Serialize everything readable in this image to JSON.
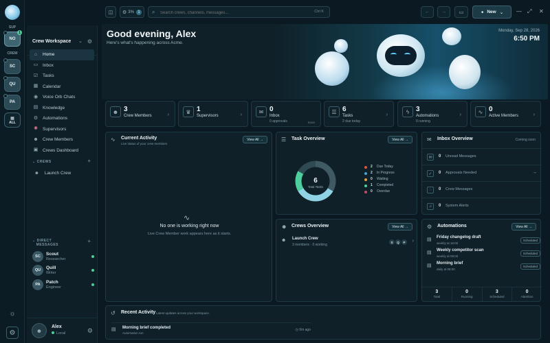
{
  "rail": {
    "sup_label": "SUP",
    "crew_label": "CREW",
    "workspaces": [
      {
        "initials": "NO",
        "badge": "1"
      },
      {
        "initials": "SC"
      },
      {
        "initials": "QU"
      },
      {
        "initials": "PA"
      }
    ],
    "all_label": "ALL"
  },
  "sidebar": {
    "workspace_name": "Crew Workspace",
    "nav": [
      "Home",
      "Inbox",
      "Tasks",
      "Calendar",
      "Voice Orb Chats",
      "Knowledge",
      "Automations",
      "Supervisors",
      "Crew Members",
      "Crews Dashboard"
    ],
    "crews_label": "CREWS",
    "crew_item": "Launch Crew",
    "dm_label_1": "DIRECT",
    "dm_label_2": "MESSAGES",
    "dms": [
      {
        "initials": "SC",
        "name": "Scout",
        "role": "Researcher"
      },
      {
        "initials": "QU",
        "name": "Quill",
        "role": "Writer"
      },
      {
        "initials": "PA",
        "name": "Patch",
        "role": "Engineer"
      }
    ],
    "user": {
      "name": "Alex",
      "status": "Local"
    }
  },
  "topbar": {
    "usage_pct": "3%",
    "usage_badge": "1",
    "search_placeholder": "Search crews, channels, messages...",
    "search_shortcut": "Ctrl K",
    "new_label": "New"
  },
  "hero": {
    "greeting": "Good evening, Alex",
    "subtitle": "Here's what's happening across Acme.",
    "date": "Monday, Sep 28, 2026",
    "time": "6:50 PM"
  },
  "stats": [
    {
      "value": "3",
      "label": "Crew Members",
      "sub": "",
      "tag": ""
    },
    {
      "value": "1",
      "label": "Supervisors",
      "sub": "",
      "tag": ""
    },
    {
      "value": "0",
      "label": "Inbox",
      "sub": "0 approvals",
      "tag": "Soon"
    },
    {
      "value": "6",
      "label": "Tasks",
      "sub": "2 due today",
      "tag": ""
    },
    {
      "value": "3",
      "label": "Automations",
      "sub": "0 running",
      "tag": ""
    },
    {
      "value": "0",
      "label": "Active Members",
      "sub": "",
      "tag": ""
    }
  ],
  "current_activity": {
    "title": "Current Activity",
    "subtitle": "Live status of your crew members",
    "view_all": "View All",
    "empty_title": "No one is working right now",
    "empty_sub": "Live Crew Member work appears here as it starts."
  },
  "task_overview": {
    "title": "Task Overview",
    "view_all": "View All",
    "center_value": "6",
    "center_label": "Total Tasks",
    "legend": [
      {
        "value": "2",
        "label": "Due Today",
        "color": "#e0533f"
      },
      {
        "value": "2",
        "label": "In Progress",
        "color": "#4aa3d8"
      },
      {
        "value": "0",
        "label": "Waiting",
        "color": "#e3a33a"
      },
      {
        "value": "1",
        "label": "Completed",
        "color": "#4ccf9d"
      },
      {
        "value": "0",
        "label": "Overdue",
        "color": "#c94a6a"
      }
    ],
    "ring": [
      {
        "value": 2,
        "color": "#3f5a63"
      },
      {
        "value": 2,
        "color": "#8fd3e4"
      },
      {
        "value": 1,
        "color": "#4ccf9d"
      },
      {
        "value": 1,
        "color": "#2f4a53"
      }
    ]
  },
  "inbox_overview": {
    "title": "Inbox Overview",
    "soon": "Coming soon",
    "rows": [
      {
        "value": "0",
        "label": "Unread Messages",
        "arrow": ""
      },
      {
        "value": "0",
        "label": "Approvals Needed",
        "arrow": "→"
      },
      {
        "value": "0",
        "label": "Crew Messages",
        "arrow": ""
      },
      {
        "value": "0",
        "label": "System Alerts",
        "arrow": ""
      }
    ]
  },
  "crews_overview": {
    "title": "Crews Overview",
    "view_all": "View All",
    "crew_name": "Launch Crew",
    "crew_status": "3 members · 0 working",
    "badges": [
      "S",
      "Q",
      "P"
    ]
  },
  "automations": {
    "title": "Automations",
    "view_all": "View All",
    "items": [
      {
        "name": "Friday changelog draft",
        "schedule": "weekly at 16:00",
        "badge": "Scheduled"
      },
      {
        "name": "Weekly competitor scan",
        "schedule": "weekly at 09:00",
        "badge": "Scheduled"
      },
      {
        "name": "Morning brief",
        "schedule": "daily at 08:00",
        "badge": "Scheduled"
      }
    ],
    "stats": [
      {
        "value": "3",
        "label": "Total"
      },
      {
        "value": "0",
        "label": "Running"
      },
      {
        "value": "3",
        "label": "Scheduled"
      },
      {
        "value": "0",
        "label": "Attention"
      }
    ]
  },
  "recent_activity": {
    "title": "Recent Activity",
    "subtitle": "Latest updates across your workspace.",
    "item_title": "Morning brief completed",
    "item_sub": "Automation run",
    "item_time": "0m ago"
  }
}
